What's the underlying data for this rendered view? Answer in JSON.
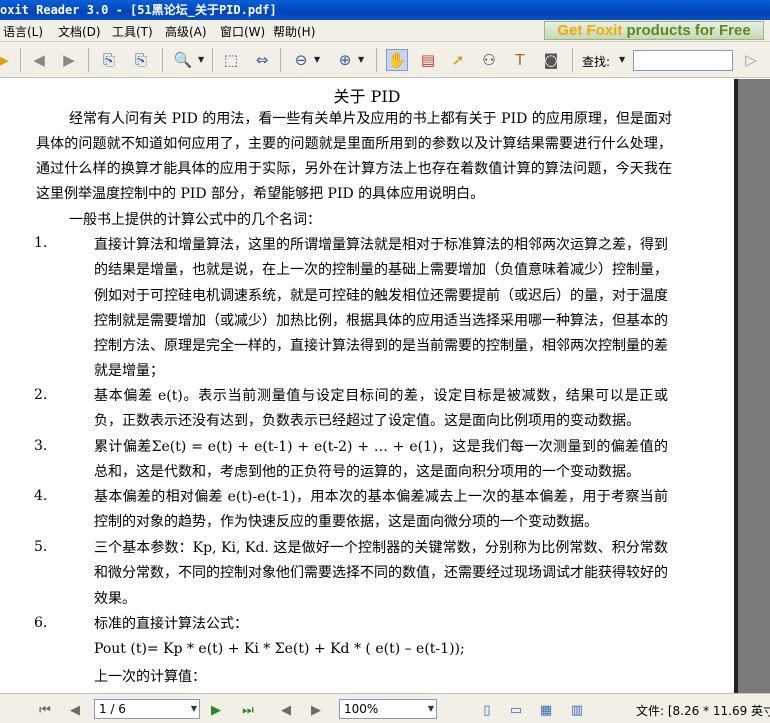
{
  "window": {
    "title": "oxit Reader 3.0 - [51黑论坛_关于PID.pdf]"
  },
  "menu": {
    "items": [
      "语言(L)",
      "文档(D)",
      "工具(T)",
      "高级(A)",
      "窗口(W)",
      "帮助(H)"
    ],
    "promo_part1": "Get Foxit",
    "promo_part2": " products for Free"
  },
  "toolbar": {
    "find_label": "查找:",
    "find_value": ""
  },
  "document": {
    "title": "关于 PID",
    "intro": "经常有人问有关 PID 的用法，看一些有关单片及应用的书上都有关于 PID 的应用原理，但是面对具体的问题就不知道如何应用了，主要的问题就是里面所用到的参数以及计算结果需要进行什么处理，通过什么样的换算才能具体的应用于实际，另外在计算方法上也存在着数值计算的算法问题，今天我在这里例举温度控制中的 PID 部分，希望能够把 PID 的具体应用说明白。",
    "subheading": "一般书上提供的计算公式中的几个名词：",
    "items": [
      {
        "num": "1.",
        "text": "直接计算法和增量算法，这里的所谓增量算法就是相对于标准算法的相邻两次运算之差，得到的结果是增量，也就是说，在上一次的控制量的基础上需要增加（负值意味着减少）控制量，例如对于可控硅电机调速系统，就是可控硅的触发相位还需要提前（或迟后）的量，对于温度控制就是需要增加（或减少）加热比例，根据具体的应用适当选择采用哪一种算法，但基本的控制方法、原理是完全一样的，直接计算法得到的是当前需要的控制量，相邻两次控制量的差就是增量；"
      },
      {
        "num": "2.",
        "text": "基本偏差 e(t)。表示当前测量值与设定目标间的差，设定目标是被减数，结果可以是正或负，正数表示还没有达到，负数表示已经超过了设定值。这是面向比例项用的变动数据。"
      },
      {
        "num": "3.",
        "text": "累计偏差Σe(t) = e(t) + e(t-1) + e(t-2) + … + e(1)，这是我们每一次测量到的偏差值的总和，这是代数和，考虑到他的正负符号的运算的，这是面向积分项用的一个变动数据。"
      },
      {
        "num": "4.",
        "text": "基本偏差的相对偏差 e(t)-e(t-1)，用本次的基本偏差减去上一次的基本偏差，用于考察当前控制的对象的趋势，作为快速反应的重要依据，这是面向微分项的一个变动数据。"
      },
      {
        "num": "5.",
        "text": "三个基本参数：Kp, Ki, Kd. 这是做好一个控制器的关键常数，分别称为比例常数、积分常数和微分常数，不同的控制对象他们需要选择不同的数值，还需要经过现场调试才能获得较好的效果。"
      },
      {
        "num": "6.",
        "text": "标准的直接计算法公式："
      }
    ],
    "formula": "Pout (t)= Kp * e(t) + Ki * Σe(t) + Kd * ( e(t) – e(t-1));",
    "last_line": "上一次的计算值："
  },
  "status": {
    "page_field": "1 / 6",
    "zoom": "100%",
    "doc_size": "文件: [8.26 * 11.69 英寸]"
  }
}
